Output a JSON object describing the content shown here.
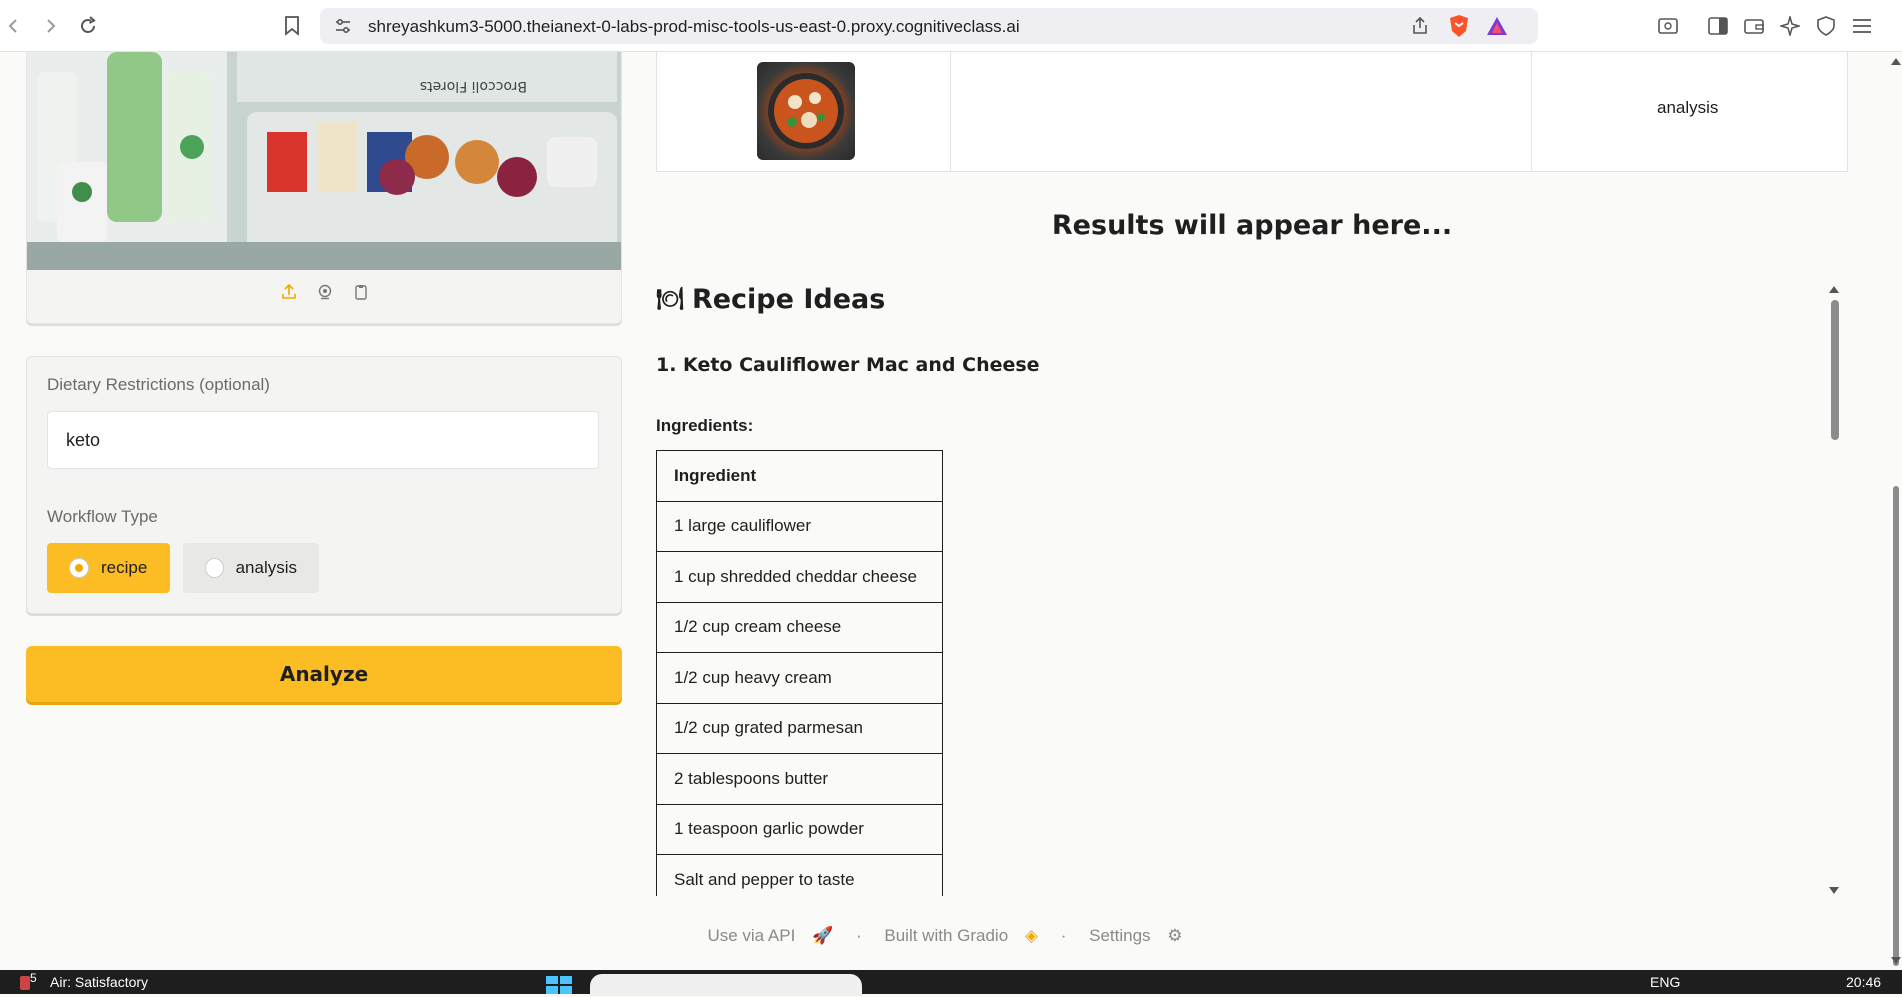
{
  "browser": {
    "url": "shreyashkum3-5000.theianext-0-labs-prod-misc-tools-us-east-0.proxy.cognitiveclass.ai"
  },
  "image_upload": {
    "tool_icons": [
      "upload-icon",
      "webcam-icon",
      "clipboard-icon"
    ],
    "fridge_label": "Broccoli Florets"
  },
  "form": {
    "dietary_label": "Dietary Restrictions (optional)",
    "dietary_value": "keto",
    "workflow_label": "Workflow Type",
    "options": [
      {
        "label": "recipe",
        "selected": true
      },
      {
        "label": "analysis",
        "selected": false
      }
    ],
    "analyze_label": "Analyze"
  },
  "gallery": {
    "row_workflow": "analysis"
  },
  "results": {
    "placeholder": "Results will appear here...",
    "section_icon": "🍽",
    "section_title": "Recipe Ideas",
    "recipe_title": "1. Keto Cauliflower Mac and Cheese",
    "ingredients_label": "Ingredients:",
    "table_header": "Ingredient",
    "ingredients": [
      "1 large cauliflower",
      "1 cup shredded cheddar cheese",
      "1/2 cup cream cheese",
      "1/2 cup heavy cream",
      "1/2 cup grated parmesan",
      "2 tablespoons butter",
      "1 teaspoon garlic powder",
      "Salt and pepper to taste"
    ]
  },
  "footer": {
    "api": "Use via API",
    "built": "Built with Gradio",
    "settings": "Settings"
  },
  "taskbar": {
    "weather_badge": "5",
    "weather_text": "Air: Satisfactory",
    "lang": "ENG",
    "time": "20:46"
  },
  "colors": {
    "accent": "#fbbd23",
    "accent_dark": "#f2a900",
    "radio_unselected": "#e8e8e6"
  }
}
